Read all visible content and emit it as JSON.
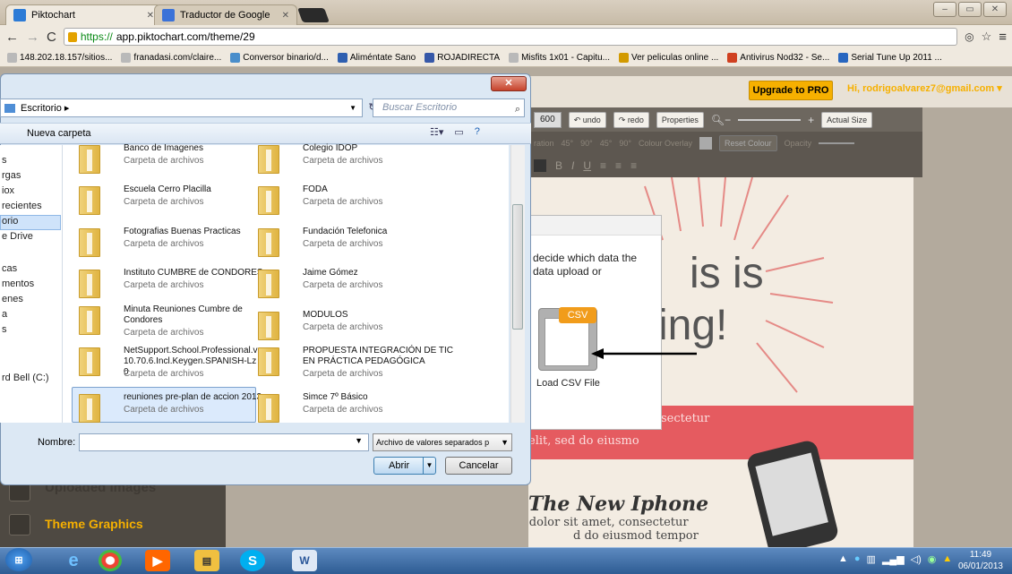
{
  "browser": {
    "tabs": [
      {
        "title": "Piktochart"
      },
      {
        "title": "Traductor de Google"
      }
    ],
    "url_scheme": "https://",
    "url_rest": "app.piktochart.com/theme/29",
    "bookmarks": [
      "148.202.18.157/sitios...",
      "franadasi.com/claire...",
      "Conversor binario/d...",
      "Aliméntate Sano",
      "ROJADIRECTA",
      "Misfits 1x01 - Capitu...",
      "Ver peliculas online ...",
      "Antivirus Nod32 - Se...",
      "Serial Tune Up 2011 ..."
    ]
  },
  "app": {
    "upgrade_label": "Upgrade to PRO",
    "user": "Hi, rodrigoalvarez7@gmail.com ▾",
    "width_value": "600",
    "undo": "undo",
    "redo": "redo",
    "properties": "Properties",
    "actual_size": "Actual Size",
    "rotation": "ration",
    "deg45a": "45°",
    "deg90a": "90°",
    "deg45b": "45°",
    "deg90b": "90°",
    "colour_overlay": "Colour Overlay",
    "reset_colour": "Reset Colour",
    "opacity": "Opacity",
    "canvas_text1": "is is",
    "canvas_text2": "ing!",
    "lorem1a": "sectetur",
    "lorem1b": "elit, sed do eiusmo",
    "iphone_title": "The New Iphone",
    "lorem2a": "Lorem ipsum dolor sit amet, consectetur",
    "lorem2b": "d do eiusmod tempor",
    "uploaded_images": "Uploaded Images",
    "theme_graphics": "Theme Graphics",
    "csv_text": "decide which data the data upload or",
    "csv_badge": "CSV",
    "csv_label": "Load CSV File"
  },
  "dialog": {
    "path": "Escritorio ▸",
    "search_placeholder": "Buscar Escritorio",
    "new_folder": "Nueva carpeta",
    "nav": [
      "s",
      "rgas",
      "iox",
      "recientes",
      "orio",
      "e Drive",
      "cas",
      "mentos",
      "enes",
      "a",
      "s",
      "rd Bell (C:)"
    ],
    "folders_left": [
      {
        "name": "Banco de Imagenes",
        "type": "Carpeta de archivos"
      },
      {
        "name": "Escuela Cerro Placilla",
        "type": "Carpeta de archivos"
      },
      {
        "name": "Fotografias Buenas Practicas",
        "type": "Carpeta de archivos"
      },
      {
        "name": "Instituto CUMBRE de CONDORES",
        "type": "Carpeta de archivos"
      },
      {
        "name": "Minuta Reuniones Cumbre de Condores",
        "type": "Carpeta de archivos"
      },
      {
        "name": "NetSupport.School.Professional.v10.70.6.Incl.Keygen.SPANISH-Lz0",
        "type": "Carpeta de archivos"
      },
      {
        "name": "reuniones pre-plan de accion 2013",
        "type": "Carpeta de archivos"
      }
    ],
    "folders_right": [
      {
        "name": "Colegio IDOP",
        "type": "Carpeta de archivos"
      },
      {
        "name": "FODA",
        "type": "Carpeta de archivos"
      },
      {
        "name": "Fundación Telefonica",
        "type": "Carpeta de archivos"
      },
      {
        "name": "Jaime Gómez",
        "type": "Carpeta de archivos"
      },
      {
        "name": "MODULOS",
        "type": "Carpeta de archivos"
      },
      {
        "name": "PROPUESTA INTEGRACIÓN DE TIC EN PRÁCTICA PEDAGÓGICA",
        "type": "Carpeta de archivos"
      },
      {
        "name": "Simce 7º Básico",
        "type": "Carpeta de archivos"
      }
    ],
    "name_label": "Nombre:",
    "file_type": "Archivo de valores separados p",
    "open_label": "Abrir",
    "cancel_label": "Cancelar"
  },
  "taskbar": {
    "time": "11:49",
    "date": "06/01/2013"
  }
}
